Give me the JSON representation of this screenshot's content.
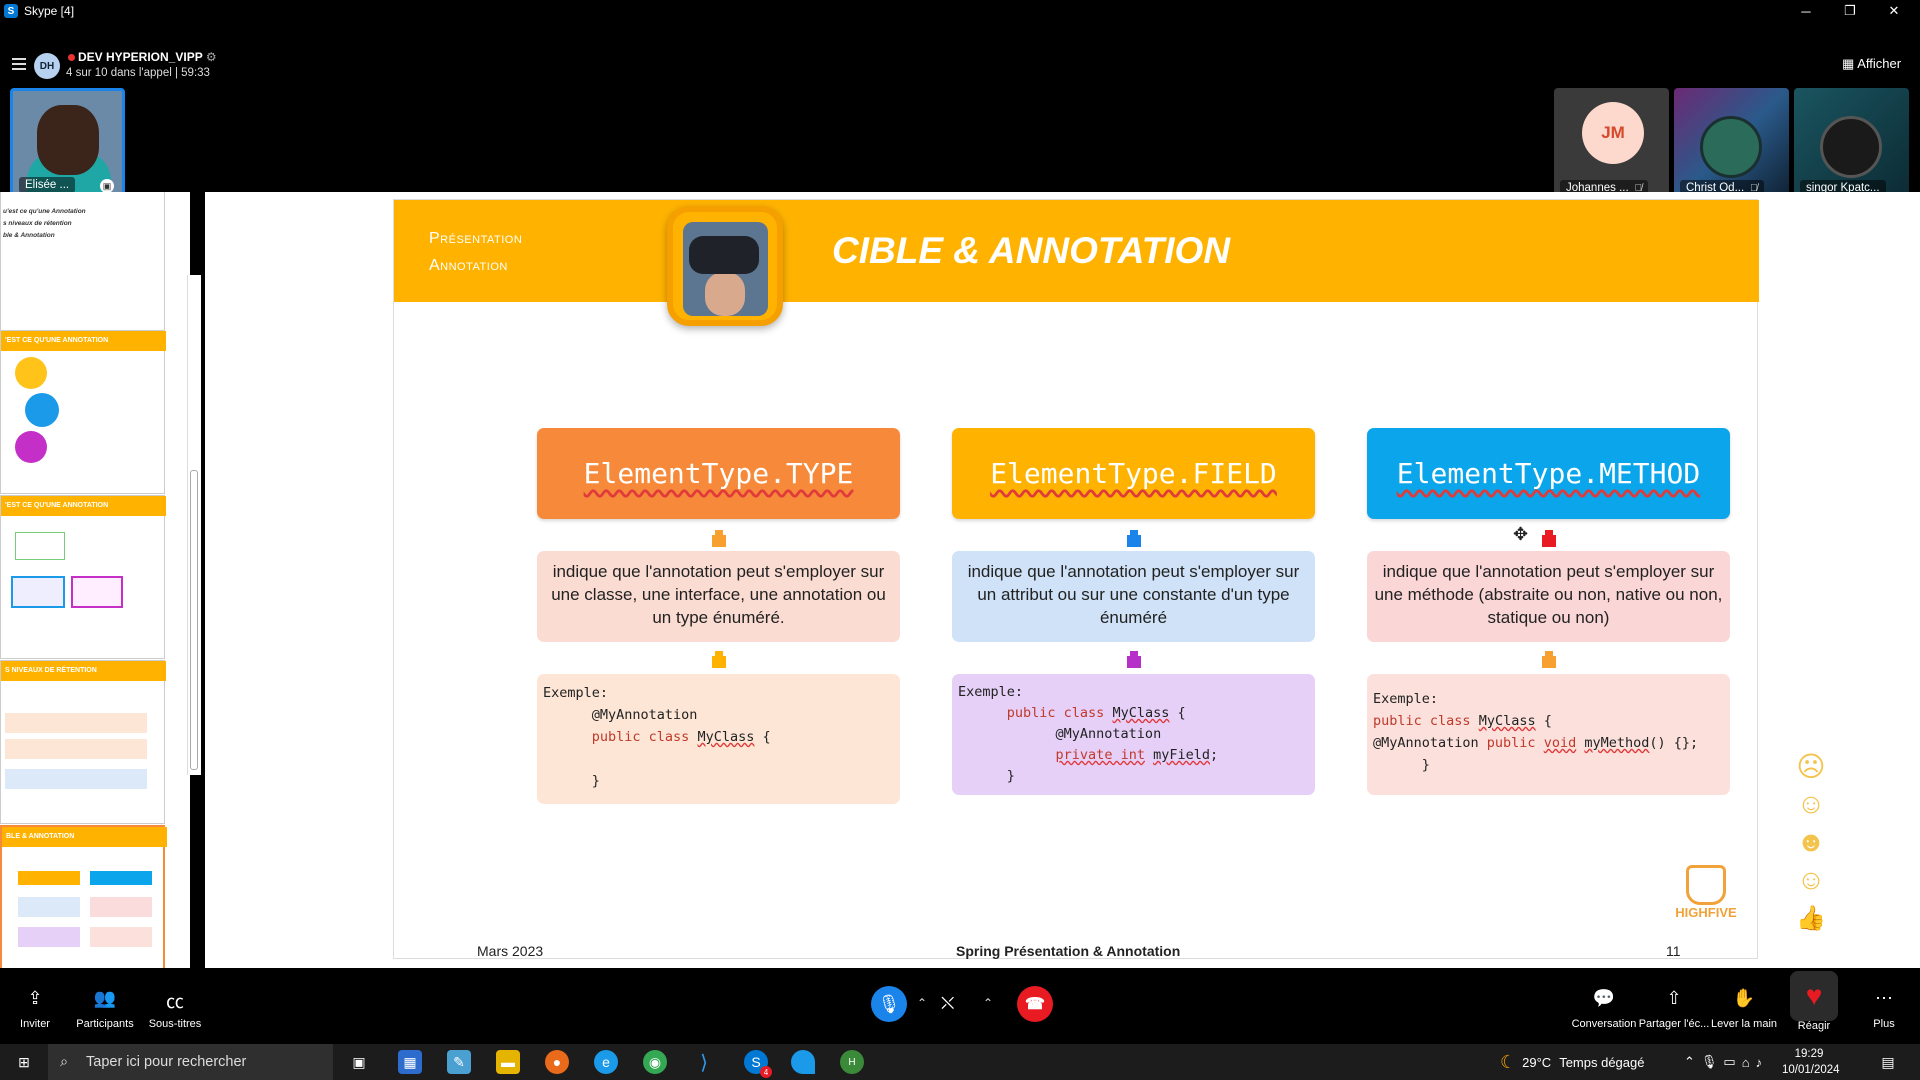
{
  "window": {
    "title": "Skype [4]",
    "minimize": "─",
    "restore": "❐",
    "close": "✕"
  },
  "call": {
    "avatar_initials": "DH",
    "group_name": "DEV HYPERION_VIPP",
    "status": "4 sur 10 dans l'appel | 59:33",
    "view_label": "Afficher"
  },
  "participants": {
    "self_name": "Elisée ...",
    "others": [
      {
        "name": "Johannes ...",
        "initials": "JM",
        "muted": true
      },
      {
        "name": "Christ Od...",
        "muted": true
      },
      {
        "name": "singor Kpatc...",
        "muted": false
      }
    ]
  },
  "thumbnails": {
    "t1_lines": [
      "u'est ce qu'une Annotation",
      "s niveaux de rétention",
      "ble & Annotation"
    ],
    "t2_title": "'EST CE QU'UNE ANNOTATION",
    "t3_title": "'EST CE QU'UNE ANNOTATION",
    "t4_title": "S NIVEAUX DE RÉTENTION",
    "t5_title": "BLE & ANNOTATION"
  },
  "slide": {
    "subtitle_line1": "Présentation",
    "subtitle_line2": "Annotation",
    "title": "CIBLE & ANNOTATION",
    "columns": [
      {
        "header": "ElementType.TYPE",
        "description": "indique que l'annotation peut s'employer sur une classe, une interface, une annotation ou un type énuméré.",
        "code_label": "Exemple:"
      },
      {
        "header": "ElementType.FIELD",
        "description": "indique que l'annotation peut s'employer sur un attribut ou sur une constante d'un type énuméré",
        "code_label": "Exemple:"
      },
      {
        "header": "ElementType.METHOD",
        "description": "indique que l'annotation peut s'employer sur une méthode (abstraite ou non, native ou non, statique ou non)",
        "code_label": "Exemple:"
      }
    ],
    "logo_text": "HIGHFIVE",
    "footer_date": "Mars 2023",
    "footer_title": "Spring Présentation & Annotation",
    "footer_page": "11"
  },
  "reactions": {
    "zoom": "1.5x"
  },
  "controls": {
    "invite": "Inviter",
    "participants": "Participants",
    "subtitles": "Sous-titres",
    "conversation": "Conversation",
    "share": "Partager l'éc...",
    "raise_hand": "Lever la main",
    "react": "Réagir",
    "more": "Plus"
  },
  "taskbar": {
    "search_placeholder": "Taper ici pour rechercher",
    "temperature": "29°C",
    "weather": "Temps dégagé",
    "time": "19:29",
    "date": "10/01/2024",
    "skype_badge": "4"
  },
  "colors": {
    "banner": "#ffb300",
    "type_header": "#f78a3a",
    "field_header": "#ffb300",
    "method_header": "#0aa5ea",
    "accent_blue": "#1a84ea",
    "hangup_red": "#e81b23"
  }
}
